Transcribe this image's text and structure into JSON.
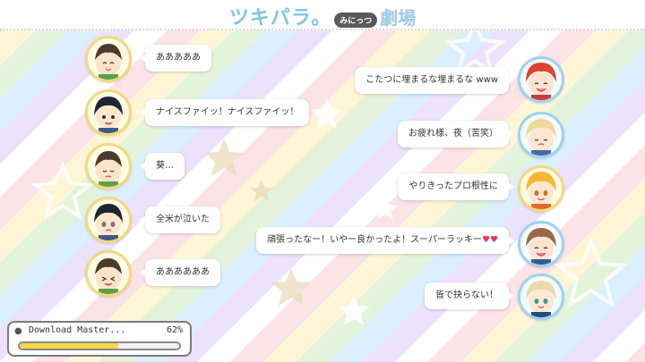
{
  "header": {
    "logo_main": "ツキパラ。",
    "logo_sub": "みにっつ",
    "logo_theater": "劇場"
  },
  "left_chat": [
    {
      "text": "あああああ",
      "avatar": "hajime-icon"
    },
    {
      "text": "ナイスファイッ！ナイスファイッ！",
      "avatar": "haru-icon"
    },
    {
      "text": "葵…",
      "avatar": "hajime-icon"
    },
    {
      "text": "全米が泣いた",
      "avatar": "haru-icon"
    },
    {
      "text": "ああああああ",
      "avatar": "hajime-icon"
    }
  ],
  "right_chat": [
    {
      "text": "こたつに埋まるな埋まるな www",
      "avatar": "red-hair-icon"
    },
    {
      "text": "お疲れ様、夜（苦笑）",
      "avatar": "blonde-hair-icon"
    },
    {
      "text": "やりきったプロ根性に",
      "avatar": "orange-hair-icon"
    },
    {
      "text": "頑張ったなー！いやー良かったよ！スーパーラッキー♥♥",
      "avatar": "brown-hair-icon"
    },
    {
      "text": "皆で抉らない！",
      "avatar": "light-blonde-icon"
    }
  ],
  "download": {
    "title": "Download Master...",
    "percent_label": "62%",
    "progress": 0.62
  },
  "colors": {
    "accent": "#7ec6e8",
    "progress_fill": "#f7d84a",
    "heart": "#e8335a"
  }
}
